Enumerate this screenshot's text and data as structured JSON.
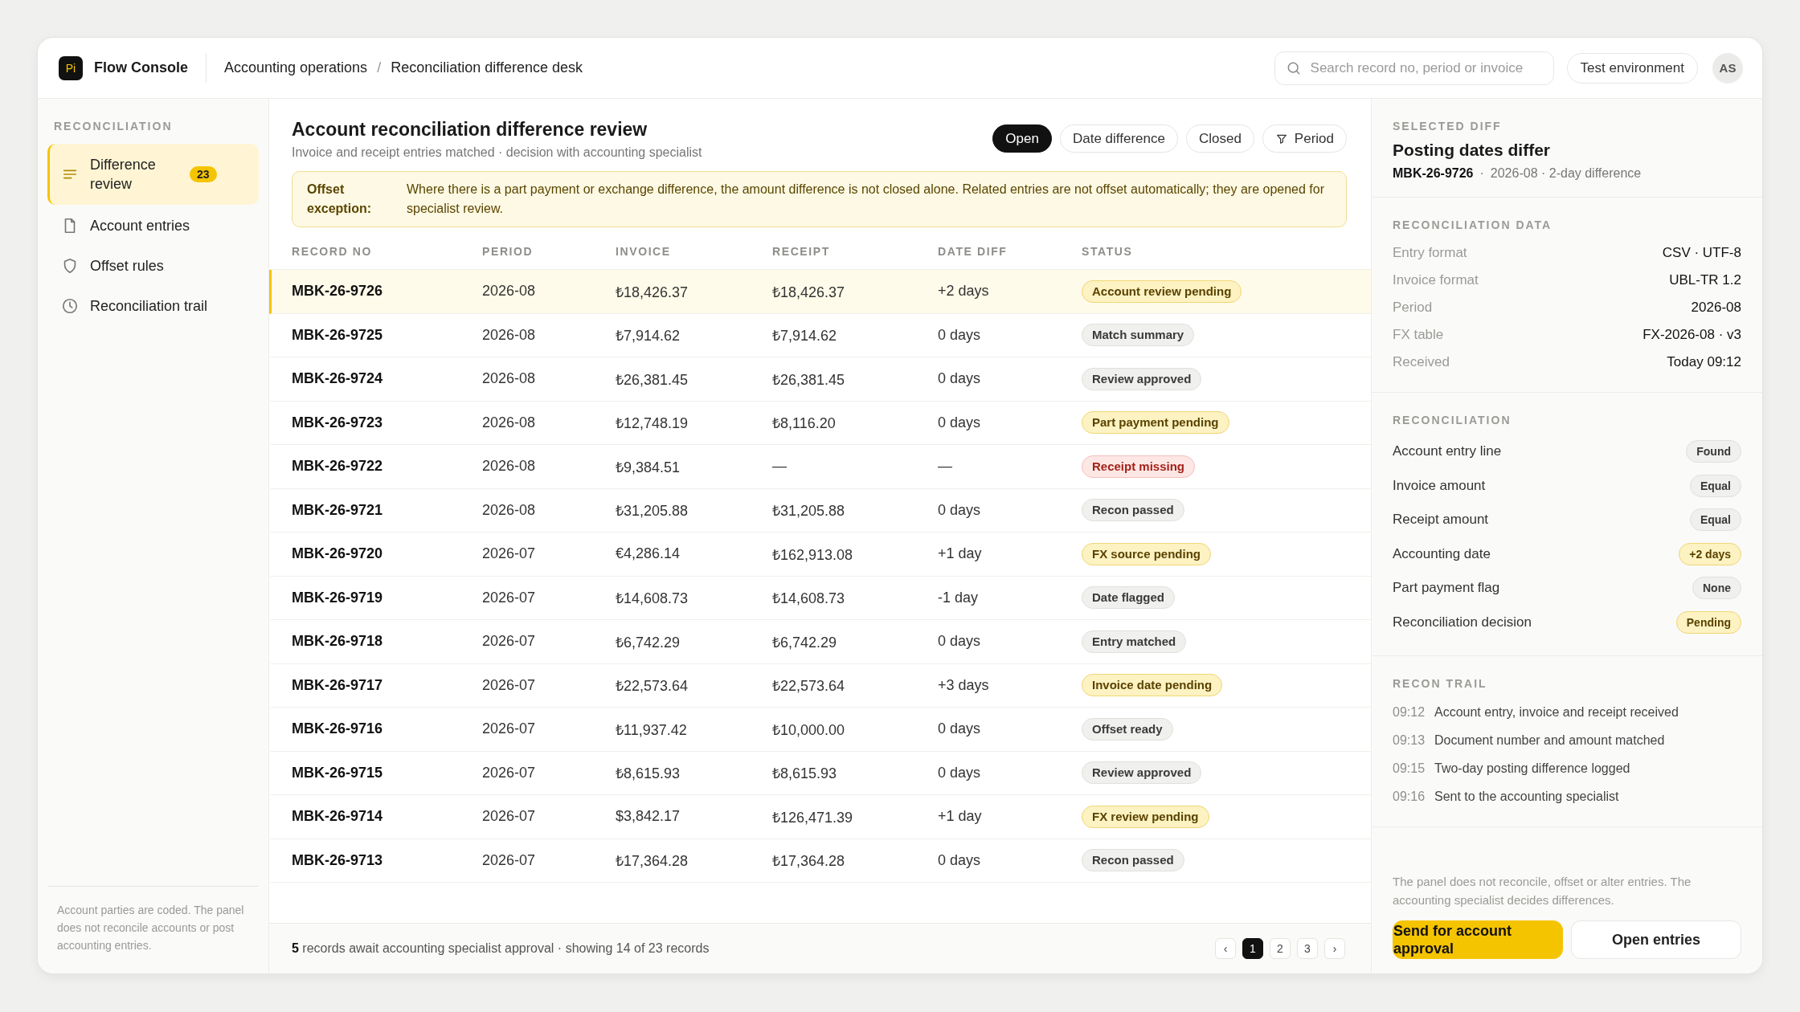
{
  "brand": {
    "logo": "Pi",
    "name": "Flow Console"
  },
  "breadcrumb": {
    "items": [
      "Accounting operations",
      "Reconciliation difference desk"
    ],
    "separator": "/"
  },
  "search": {
    "placeholder": "Search record no, period or invoice"
  },
  "environment": "Test environment",
  "avatar": "AS",
  "sidebar": {
    "heading": "RECONCILIATION",
    "items": [
      {
        "label": "Difference review",
        "count": "23",
        "selected": true
      },
      {
        "label": "Account entries",
        "selected": false
      },
      {
        "label": "Offset rules",
        "selected": false
      },
      {
        "label": "Reconciliation trail",
        "selected": false
      }
    ],
    "note": "Account parties are coded. The panel does not reconcile accounts or post accounting entries."
  },
  "review": {
    "title": "Account reconciliation difference review",
    "subtitle": "Invoice and receipt entries matched · decision with accounting specialist",
    "filters": [
      {
        "label": "Open",
        "kind": "toggle",
        "selected": true
      },
      {
        "label": "Date difference",
        "kind": "toggle",
        "selected": false
      },
      {
        "label": "Closed",
        "kind": "toggle",
        "selected": false
      },
      {
        "label": "Period",
        "kind": "filter",
        "selected": false
      }
    ],
    "callout": {
      "label": "Offset exception:",
      "text": "Where there is a part payment or exchange difference, the amount difference is not closed alone. Related entries are not offset automatically; they are opened for specialist review."
    },
    "table": {
      "columns": [
        "RECORD NO",
        "PERIOD",
        "INVOICE",
        "RECEIPT",
        "DATE DIFF",
        "STATUS"
      ],
      "rows": [
        {
          "record_no": "MBK-26-9726",
          "period": "2026-08",
          "invoice": "₺18,426.37",
          "receipt": "₺18,426.37",
          "date_diff": "+2 days",
          "status": {
            "label": "Account review pending",
            "kind": "warning"
          },
          "selected": true
        },
        {
          "record_no": "MBK-26-9725",
          "period": "2026-08",
          "invoice": "₺7,914.62",
          "receipt": "₺7,914.62",
          "date_diff": "0 days",
          "status": {
            "label": "Match summary",
            "kind": "neutral"
          },
          "selected": false
        },
        {
          "record_no": "MBK-26-9724",
          "period": "2026-08",
          "invoice": "₺26,381.45",
          "receipt": "₺26,381.45",
          "date_diff": "0 days",
          "status": {
            "label": "Review approved",
            "kind": "neutral"
          },
          "selected": false
        },
        {
          "record_no": "MBK-26-9723",
          "period": "2026-08",
          "invoice": "₺12,748.19",
          "receipt": "₺8,116.20",
          "date_diff": "0 days",
          "status": {
            "label": "Part payment pending",
            "kind": "warning"
          },
          "selected": false
        },
        {
          "record_no": "MBK-26-9722",
          "period": "2026-08",
          "invoice": "₺9,384.51",
          "receipt": "—",
          "date_diff": "—",
          "status": {
            "label": "Receipt missing",
            "kind": "danger"
          },
          "selected": false
        },
        {
          "record_no": "MBK-26-9721",
          "period": "2026-08",
          "invoice": "₺31,205.88",
          "receipt": "₺31,205.88",
          "date_diff": "0 days",
          "status": {
            "label": "Recon passed",
            "kind": "neutral"
          },
          "selected": false
        },
        {
          "record_no": "MBK-26-9720",
          "period": "2026-07",
          "invoice": "€4,286.14",
          "receipt": "₺162,913.08",
          "date_diff": "+1 day",
          "status": {
            "label": "FX source pending",
            "kind": "warning"
          },
          "selected": false
        },
        {
          "record_no": "MBK-26-9719",
          "period": "2026-07",
          "invoice": "₺14,608.73",
          "receipt": "₺14,608.73",
          "date_diff": "-1 day",
          "status": {
            "label": "Date flagged",
            "kind": "neutral"
          },
          "selected": false
        },
        {
          "record_no": "MBK-26-9718",
          "period": "2026-07",
          "invoice": "₺6,742.29",
          "receipt": "₺6,742.29",
          "date_diff": "0 days",
          "status": {
            "label": "Entry matched",
            "kind": "neutral"
          },
          "selected": false
        },
        {
          "record_no": "MBK-26-9717",
          "period": "2026-07",
          "invoice": "₺22,573.64",
          "receipt": "₺22,573.64",
          "date_diff": "+3 days",
          "status": {
            "label": "Invoice date pending",
            "kind": "warning"
          },
          "selected": false
        },
        {
          "record_no": "MBK-26-9716",
          "period": "2026-07",
          "invoice": "₺11,937.42",
          "receipt": "₺10,000.00",
          "date_diff": "0 days",
          "status": {
            "label": "Offset ready",
            "kind": "neutral"
          },
          "selected": false
        },
        {
          "record_no": "MBK-26-9715",
          "period": "2026-07",
          "invoice": "₺8,615.93",
          "receipt": "₺8,615.93",
          "date_diff": "0 days",
          "status": {
            "label": "Review approved",
            "kind": "neutral"
          },
          "selected": false
        },
        {
          "record_no": "MBK-26-9714",
          "period": "2026-07",
          "invoice": "$3,842.17",
          "receipt": "₺126,471.39",
          "date_diff": "+1 day",
          "status": {
            "label": "FX review pending",
            "kind": "warning"
          },
          "selected": false
        },
        {
          "record_no": "MBK-26-9713",
          "period": "2026-07",
          "invoice": "₺17,364.28",
          "receipt": "₺17,364.28",
          "date_diff": "0 days",
          "status": {
            "label": "Recon passed",
            "kind": "neutral"
          },
          "selected": false
        }
      ]
    },
    "footer": {
      "summary": "**5** records await accounting specialist approval · showing 14 of 23 records",
      "prev": "‹",
      "next": "›",
      "pages": [
        {
          "label": "1",
          "selected": true
        },
        {
          "label": "2",
          "selected": false
        },
        {
          "label": "3",
          "selected": false
        }
      ]
    }
  },
  "detail": {
    "heading": "SELECTED DIFF",
    "title": "Posting dates differ",
    "record": "MBK-26-9726",
    "separator": "·",
    "meta": "2026-08 · 2-day difference",
    "data_heading": "RECONCILIATION DATA",
    "data": [
      {
        "label": "Entry format",
        "value": "CSV · UTF-8"
      },
      {
        "label": "Invoice format",
        "value": "UBL-TR 1.2"
      },
      {
        "label": "Period",
        "value": "2026-08"
      },
      {
        "label": "FX table",
        "value": "FX-2026-08 · v3"
      },
      {
        "label": "Received",
        "value": "Today 09:12"
      }
    ],
    "checks_heading": "RECONCILIATION",
    "checks": [
      {
        "label": "Account entry line",
        "value": "Found",
        "kind": "neutral"
      },
      {
        "label": "Invoice amount",
        "value": "Equal",
        "kind": "neutral"
      },
      {
        "label": "Receipt amount",
        "value": "Equal",
        "kind": "neutral"
      },
      {
        "label": "Accounting date",
        "value": "+2 days",
        "kind": "warning"
      },
      {
        "label": "Part payment flag",
        "value": "None",
        "kind": "neutral"
      },
      {
        "label": "Reconciliation decision",
        "value": "Pending",
        "kind": "warning"
      }
    ],
    "trail_heading": "RECON TRAIL",
    "trail": [
      {
        "time": "09:12",
        "text": "Account entry, invoice and receipt received"
      },
      {
        "time": "09:13",
        "text": "Document number and amount matched"
      },
      {
        "time": "09:15",
        "text": "Two-day posting difference logged"
      },
      {
        "time": "09:16",
        "text": "Sent to the accounting specialist"
      }
    ],
    "note": "The panel does not reconcile, offset or alter entries. The accounting specialist decides differences.",
    "actions": [
      {
        "label": "Send for account approval",
        "kind": "primary"
      },
      {
        "label": "Open entries",
        "kind": "secondary"
      }
    ]
  }
}
